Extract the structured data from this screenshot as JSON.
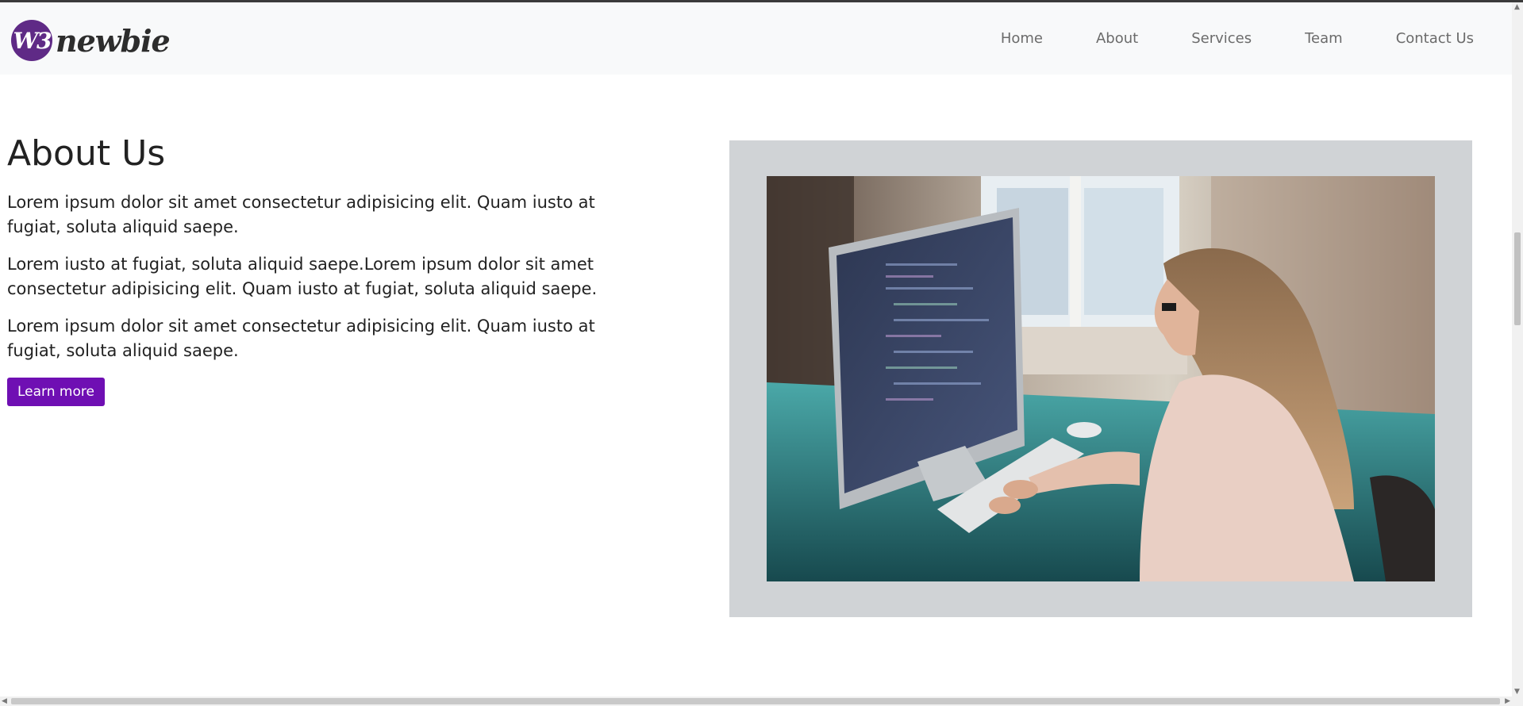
{
  "brand": {
    "logo_mark": "W3",
    "logo_word": "newbie",
    "logo_color": "#5f2a86"
  },
  "nav": {
    "items": [
      {
        "label": "Home"
      },
      {
        "label": "About"
      },
      {
        "label": "Services"
      },
      {
        "label": "Team"
      },
      {
        "label": "Contact Us"
      }
    ]
  },
  "about": {
    "title": "About Us",
    "paragraphs": [
      "Lorem ipsum dolor sit amet consectetur adipisicing elit. Quam iusto at fugiat, soluta aliquid saepe.",
      "Lorem iusto at fugiat, soluta aliquid saepe.Lorem ipsum dolor sit amet consectetur adipisicing elit. Quam iusto at fugiat, soluta aliquid saepe.",
      "Lorem ipsum dolor sit amet consectetur adipisicing elit. Quam iusto at fugiat, soluta aliquid saepe."
    ],
    "button_label": "Learn more",
    "button_color": "#6f0fb3"
  },
  "image": {
    "alt": "woman-coding-at-computer-photo"
  }
}
